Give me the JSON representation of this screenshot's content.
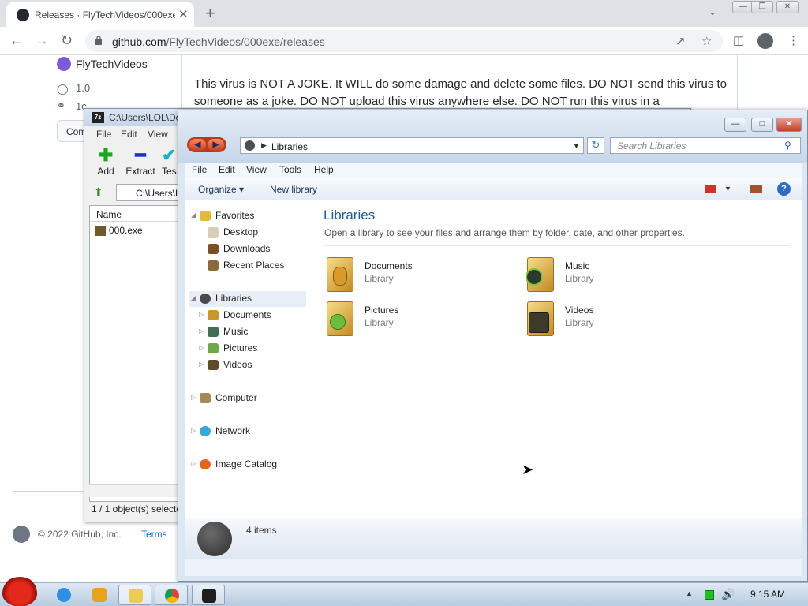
{
  "browser": {
    "tab_title": "Releases · FlyTechVideos/000exe",
    "tab_close": "✕",
    "new_tab": "+",
    "tab_search": "⌄",
    "window_controls": [
      "—",
      "❐",
      "✕"
    ],
    "url_host": "github.com",
    "url_path": "/FlyTechVideos/000exe/releases"
  },
  "github": {
    "author": "FlyTechVideos",
    "tag": "1.0",
    "commit": "1c",
    "compare_button": "Com",
    "release_text": "This virus is NOT A JOKE. It WILL do some damage and delete some files. DO NOT send this virus to someone as a joke. DO NOT upload this virus anywhere else. DO NOT run this virus in a",
    "copyright": "© 2022 GitHub, Inc.",
    "terms": "Terms"
  },
  "sevenzip": {
    "icon_text": "7z",
    "title": "C:\\Users\\LOL\\Do",
    "menu": [
      "File",
      "Edit",
      "View"
    ],
    "tools": [
      {
        "label": "Add",
        "glyph": "✚",
        "color": "#1aa61a"
      },
      {
        "label": "Extract",
        "glyph": "━",
        "color": "#1c2fc8"
      },
      {
        "label": "Tes",
        "glyph": "✔",
        "color": "#1ab0c8"
      }
    ],
    "path": "C:\\Users\\L",
    "column_name": "Name",
    "file_name": "000.exe",
    "status": "1 / 1 object(s) selecte"
  },
  "explorer": {
    "address_crumb": "Libraries",
    "search_placeholder": "Search Libraries",
    "menu": [
      "File",
      "Edit",
      "View",
      "Tools",
      "Help"
    ],
    "organize": "Organize ▾",
    "new_library": "New library",
    "help_glyph": "?",
    "nav": {
      "favorites": "Favorites",
      "desktop": "Desktop",
      "downloads": "Downloads",
      "recent_places": "Recent Places",
      "libraries": "Libraries",
      "documents": "Documents",
      "music": "Music",
      "pictures": "Pictures",
      "videos": "Videos",
      "computer": "Computer",
      "network": "Network",
      "image_catalog": "Image Catalog"
    },
    "heading": "Libraries",
    "subheading": "Open a library to see your files and arrange them by folder, date, and other properties.",
    "libraries": [
      {
        "name": "Documents",
        "type": "Library"
      },
      {
        "name": "Music",
        "type": "Library"
      },
      {
        "name": "Pictures",
        "type": "Library"
      },
      {
        "name": "Videos",
        "type": "Library"
      }
    ],
    "item_count": "4 items"
  },
  "taskbar": {
    "clock": "9:15 AM"
  }
}
